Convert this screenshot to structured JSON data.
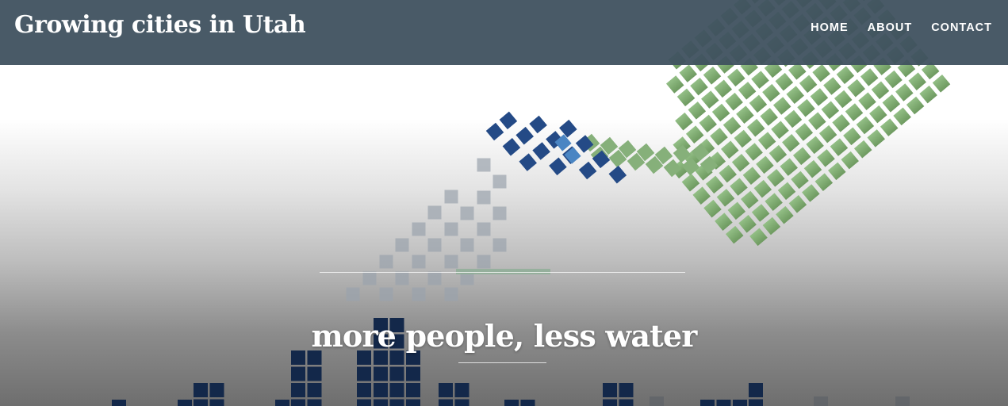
{
  "site": {
    "title": "Growing cities in Utah"
  },
  "nav": {
    "items": [
      {
        "label": "HOME",
        "name": "nav-home"
      },
      {
        "label": "ABOUT",
        "name": "nav-about"
      },
      {
        "label": "CONTACT",
        "name": "nav-contact"
      }
    ]
  },
  "hero": {
    "tagline": "more people, less water"
  },
  "colors": {
    "navbar": "#3f515f",
    "green_tiles": "#8fb882",
    "blue_tiles": "#244a86",
    "light_blue_tiles": "#4a85c3",
    "grey_tiles": "#9aa3ad",
    "city_blocks": "#13284a"
  }
}
